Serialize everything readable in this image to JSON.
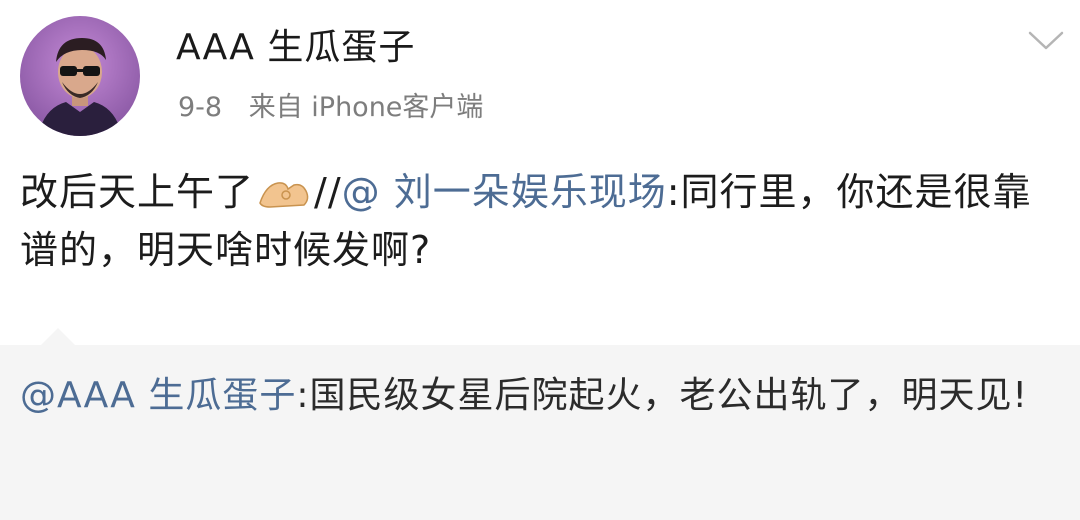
{
  "post": {
    "author": "AAA 生瓜蛋子",
    "date": "9-8",
    "source": "来自 iPhone客户端",
    "body": {
      "text_before": "改后天上午了",
      "emoji": "ok-hand-emoji",
      "repost_prefix": "//",
      "mention": "@ 刘一朵娱乐现场",
      "text_after": ":同行里，你还是很靠谱的，明天啥时候发啊?"
    }
  },
  "quote": {
    "mention": "@AAA 生瓜蛋子",
    "text": ":国民级女星后院起火，老公出轨了，明天见!"
  },
  "icons": {
    "menu": "chevron-down-icon",
    "avatar": "avatar-portrait"
  },
  "colors": {
    "mention": "#4d6c94",
    "quote_background": "#f5f5f5",
    "meta_text": "#7d7d7d",
    "avatar_background": "#a46fb8"
  }
}
